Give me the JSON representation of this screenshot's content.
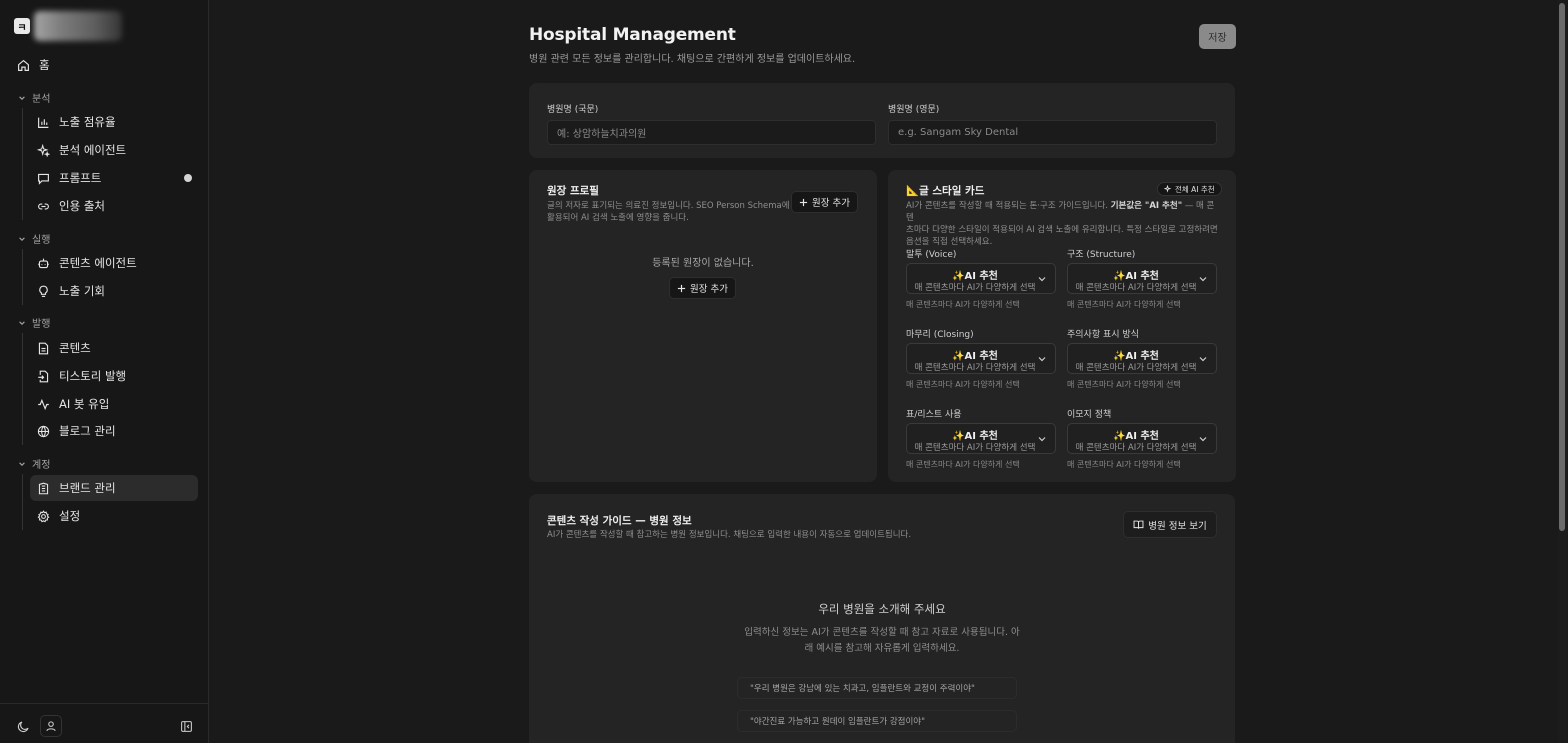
{
  "brand": {
    "logo_char": "ㅋ"
  },
  "sidebar": {
    "home": "홈",
    "groups": {
      "analysis": "분석",
      "execute": "실행",
      "publish": "발행",
      "account": "계정"
    },
    "items": {
      "exposure_share": "노출 점유율",
      "analysis_agent": "분석 에이전트",
      "prompt": "프롬프트",
      "citation_source": "인용 출처",
      "content_agent": "콘텐츠 에이전트",
      "exposure_opportunity": "노출 기회",
      "contents": "콘텐츠",
      "tistory_publish": "티스토리 발행",
      "ai_bot_inflow": "AI 봇 유입",
      "blog_manage": "블로그 관리",
      "brand_manage": "브랜드 관리",
      "settings": "설정"
    }
  },
  "header": {
    "title": "Hospital Management",
    "subtitle": "병원 관련 모든 정보를 관리합니다. 채팅으로 간편하게 정보를 업데이트하세요.",
    "save_label": "저장"
  },
  "hospital_name": {
    "ko_label": "병원명 (국문)",
    "ko_placeholder": "예: 상암하늘치과의원",
    "en_label": "병원명 (영문)",
    "en_placeholder": "e.g. Sangam Sky Dental"
  },
  "director": {
    "title": "원장 프로필",
    "desc_line1": "글의 저자로 표기되는 의료진 정보입니다. SEO Person Schema에",
    "desc_line2": "활용되어 AI 검색 노출에 영향을 줍니다.",
    "add_label": "원장 추가",
    "empty_text": "등록된 원장이 없습니다.",
    "empty_add_label": "원장 추가"
  },
  "style_card": {
    "title": "글 스타일 카드",
    "title_icon": "📐",
    "all_ai_label": "전체 AI 추천",
    "desc_line1_pre": "AI가 콘텐츠를 작성할 때 적용되는 톤·구조 가이드입니다. ",
    "desc_line1_bold": "기본값은 \"AI 추천\"",
    "desc_line1_post": " — 매 콘텐",
    "desc_line2": "츠마다 다양한 스타일이 적용되어 AI 검색 노출에 유리합니다. 특정 스타일로 고정하려면",
    "desc_line3": "옵션을 직접 선택하세요.",
    "fields": [
      {
        "label": "말투 (Voice)",
        "value": "✨AI 추천",
        "sub": "매 콘텐츠마다 AI가 다양하게 선택",
        "help": "매 콘텐츠마다 AI가 다양하게 선택"
      },
      {
        "label": "구조 (Structure)",
        "value": "✨AI 추천",
        "sub": "매 콘텐츠마다 AI가 다양하게 선택",
        "help": "매 콘텐츠마다 AI가 다양하게 선택"
      },
      {
        "label": "마무리 (Closing)",
        "value": "✨AI 추천",
        "sub": "매 콘텐츠마다 AI가 다양하게 선택",
        "help": "매 콘텐츠마다 AI가 다양하게 선택"
      },
      {
        "label": "주의사항 표시 방식",
        "value": "✨AI 추천",
        "sub": "매 콘텐츠마다 AI가 다양하게 선택",
        "help": "매 콘텐츠마다 AI가 다양하게 선택"
      },
      {
        "label": "표/리스트 사용",
        "value": "✨AI 추천",
        "sub": "매 콘텐츠마다 AI가 다양하게 선택",
        "help": "매 콘텐츠마다 AI가 다양하게 선택"
      },
      {
        "label": "이모지 정책",
        "value": "✨AI 추천",
        "sub": "매 콘텐츠마다 AI가 다양하게 선택",
        "help": "매 콘텐츠마다 AI가 다양하게 선택"
      }
    ]
  },
  "guide": {
    "title": "콘텐츠 작성 가이드 — 병원 정보",
    "desc": "AI가 콘텐츠를 작성할 때 참고하는 병원 정보입니다. 채팅으로 입력한 내용이 자동으로 업데이트됩니다.",
    "view_label": "병원 정보 보기",
    "intro_title": "우리 병원을 소개해 주세요",
    "intro_line1": "입력하신 정보는 AI가 콘텐츠를 작성할 때 참고 자료로 사용됩니다. 아",
    "intro_line2": "래 예시를 참고해 자유롭게 입력하세요.",
    "examples": [
      "\"우리 병원은 강남에 있는 치과고, 임플란트와 교정이 주력이야\"",
      "\"야간진료 가능하고 원데이 임플란트가 강점이야\""
    ]
  }
}
